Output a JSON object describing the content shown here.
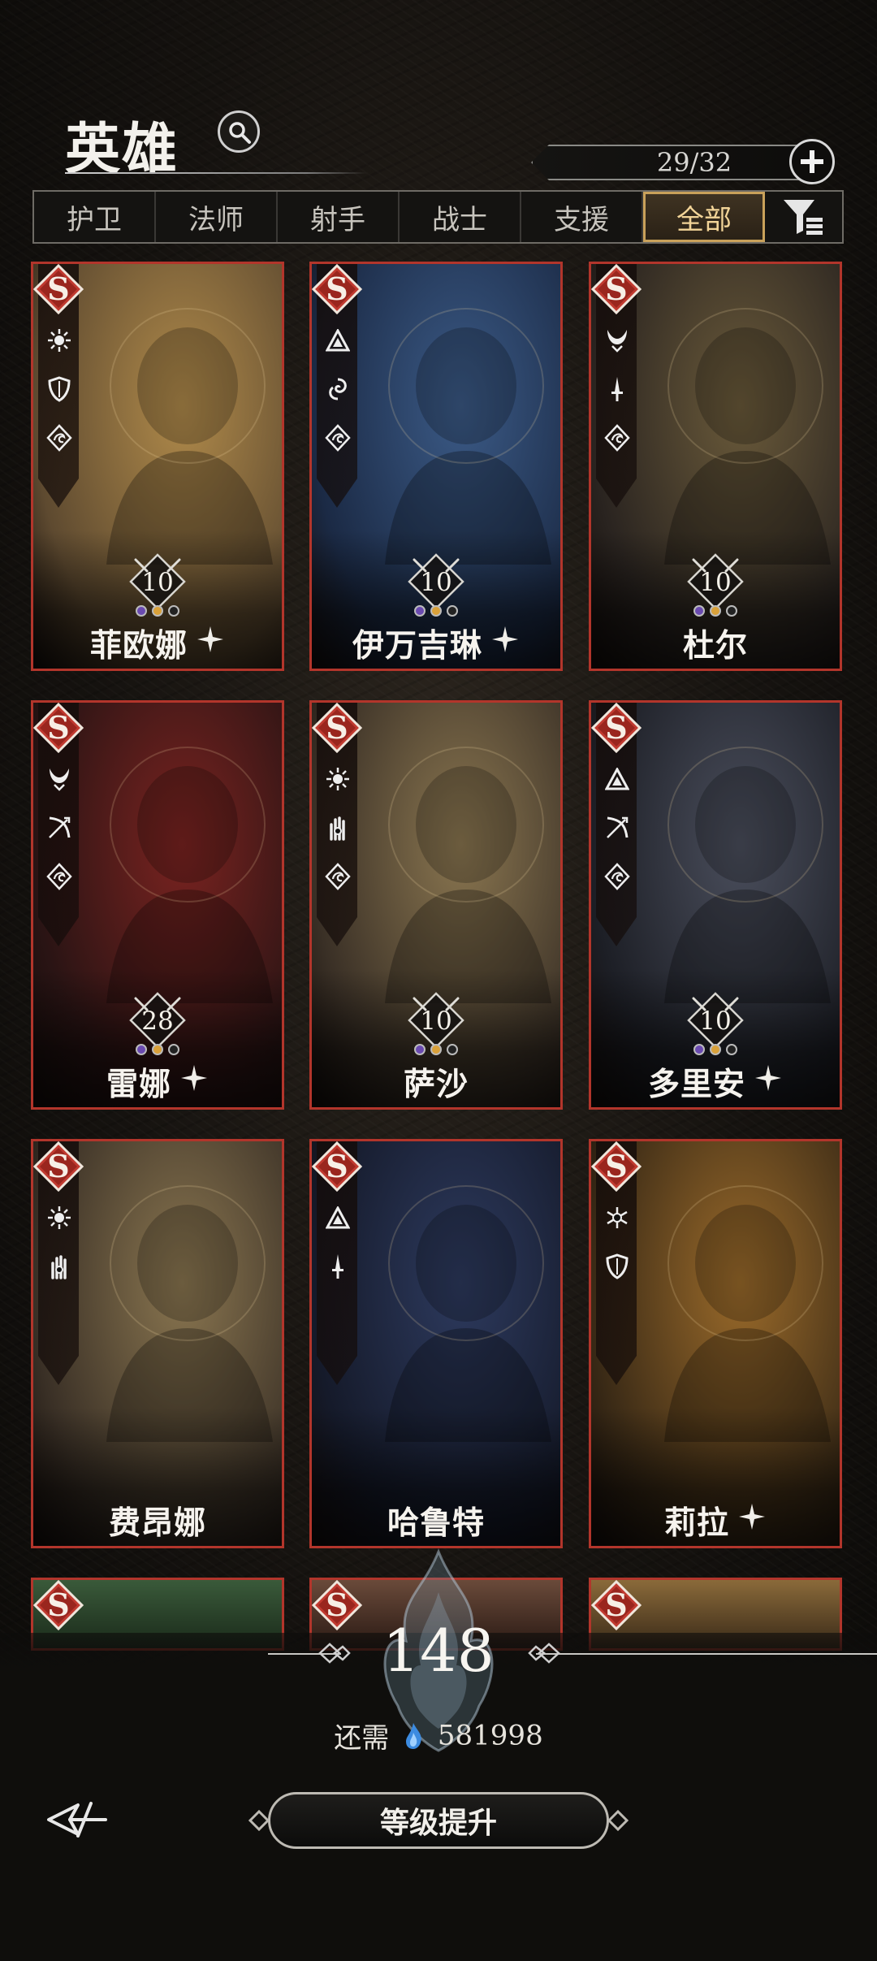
{
  "header": {
    "title": "英雄",
    "counter": "29/32"
  },
  "tabs": [
    {
      "label": "护卫"
    },
    {
      "label": "法师"
    },
    {
      "label": "射手"
    },
    {
      "label": "战士"
    },
    {
      "label": "支援"
    },
    {
      "label": "全部",
      "active": true
    }
  ],
  "heroes": [
    {
      "name": "菲欧娜",
      "level": "10",
      "star": true,
      "icons": [
        "sun-icon",
        "shield-icon",
        "dragon-icon"
      ],
      "palette": [
        "#b08a4a",
        "#5e4a30"
      ]
    },
    {
      "name": "伊万吉琳",
      "level": "10",
      "star": true,
      "icons": [
        "triangle-icon",
        "swirl-icon",
        "dragon-icon"
      ],
      "palette": [
        "#3b5a86",
        "#1b2a45"
      ]
    },
    {
      "name": "杜尔",
      "level": "10",
      "star": false,
      "icons": [
        "horns-icon",
        "sword-icon",
        "dragon-icon"
      ],
      "palette": [
        "#6a5a3a",
        "#2a2420"
      ]
    },
    {
      "name": "雷娜",
      "level": "28",
      "star": true,
      "icons": [
        "horns-icon",
        "bow-icon",
        "dragon-icon"
      ],
      "palette": [
        "#7a2320",
        "#2a1414"
      ]
    },
    {
      "name": "萨沙",
      "level": "10",
      "star": false,
      "icons": [
        "sun-icon",
        "hand-icon",
        "dragon-icon"
      ],
      "palette": [
        "#8a7650",
        "#3a3026"
      ]
    },
    {
      "name": "多里安",
      "level": "10",
      "star": true,
      "icons": [
        "triangle-icon",
        "bow-icon",
        "dragon-icon"
      ],
      "palette": [
        "#4a4e5c",
        "#1d1f26"
      ]
    },
    {
      "name": "费昂娜",
      "level": "",
      "star": false,
      "icons": [
        "sun-icon",
        "hand-icon"
      ],
      "palette": [
        "#8a7650",
        "#3a3026"
      ]
    },
    {
      "name": "哈鲁特",
      "level": "",
      "star": false,
      "icons": [
        "triangle-icon",
        "sword-icon"
      ],
      "palette": [
        "#2d3a5e",
        "#151a2a"
      ]
    },
    {
      "name": "莉拉",
      "level": "",
      "star": true,
      "icons": [
        "snow-icon",
        "shield-icon"
      ],
      "palette": [
        "#9a6a2a",
        "#3a2a16"
      ]
    }
  ],
  "partial_row_palettes": [
    [
      "#3a5a3a",
      "#1a2a1a"
    ],
    [
      "#6a4a3a",
      "#2a1a14"
    ],
    [
      "#8a6a3a",
      "#3a2a18"
    ]
  ],
  "level_panel": {
    "current_level": "148",
    "need_label": "还需",
    "need_amount": "581998",
    "upgrade_label": "等级提升"
  },
  "colors": {
    "card_border": "#b2352b",
    "tab_active_border": "#c9a15a",
    "tab_active_text": "#f2d498"
  }
}
